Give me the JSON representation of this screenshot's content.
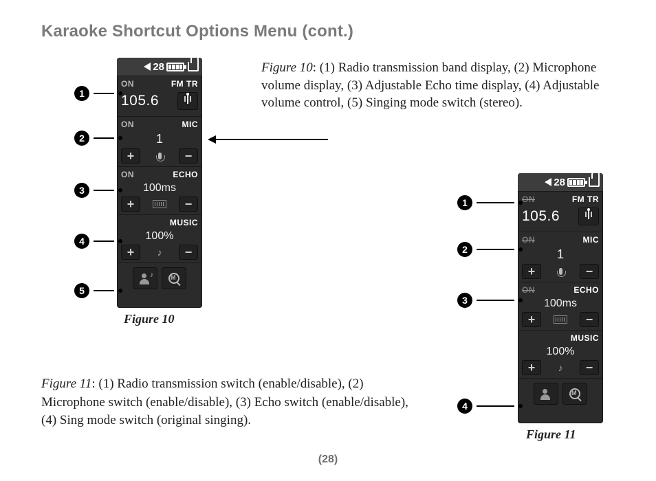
{
  "page": {
    "title": "Karaoke Shortcut Options Menu (cont.)",
    "number": "(28)"
  },
  "captions": {
    "fig10": {
      "label": "Figure 10",
      "text": ": (1) Radio transmission band display, (2) Microphone volume display, (3) Adjustable Echo time display, (4) Adjustable volume control, (5) Singing mode switch (stereo)."
    },
    "fig11": {
      "label": "Figure 11",
      "text": ": (1) Radio transmission switch (enable/disable), (2) Microphone switch (enable/disable), (3) Echo switch (enable/disable), (4) Sing mode switch (original singing)."
    }
  },
  "device": {
    "status": {
      "volume": "28"
    },
    "fmtr": {
      "on_label": "ON",
      "label": "FM TR",
      "frequency": "105.6"
    },
    "mic": {
      "on_label": "ON",
      "label": "MIC",
      "value": "1"
    },
    "echo": {
      "on_label": "ON",
      "label": "ECHO",
      "value": "100ms"
    },
    "music": {
      "label": "MUSIC",
      "value": "100%"
    },
    "plus": "+",
    "minus": "−"
  },
  "figure_labels": {
    "fig10": "Figure 10",
    "fig11": "Figure 11"
  }
}
